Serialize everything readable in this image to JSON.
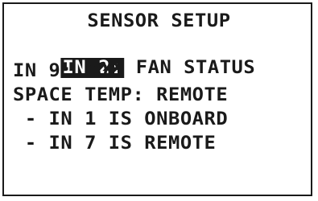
{
  "screen": {
    "title": "SENSOR SETUP",
    "lines": [
      {
        "selected_part": "IN 2:",
        "rest": " FAN STATUS"
      },
      {
        "text": "IN 9: CO2"
      },
      {
        "text": "SPACE TEMP: REMOTE"
      },
      {
        "text": " - IN 1 IS ONBOARD"
      },
      {
        "text": " - IN 7 IS REMOTE"
      }
    ]
  },
  "colors": {
    "foreground": "#1a1a1a",
    "background": "#ffffff",
    "highlight_text": "#ffffff"
  }
}
